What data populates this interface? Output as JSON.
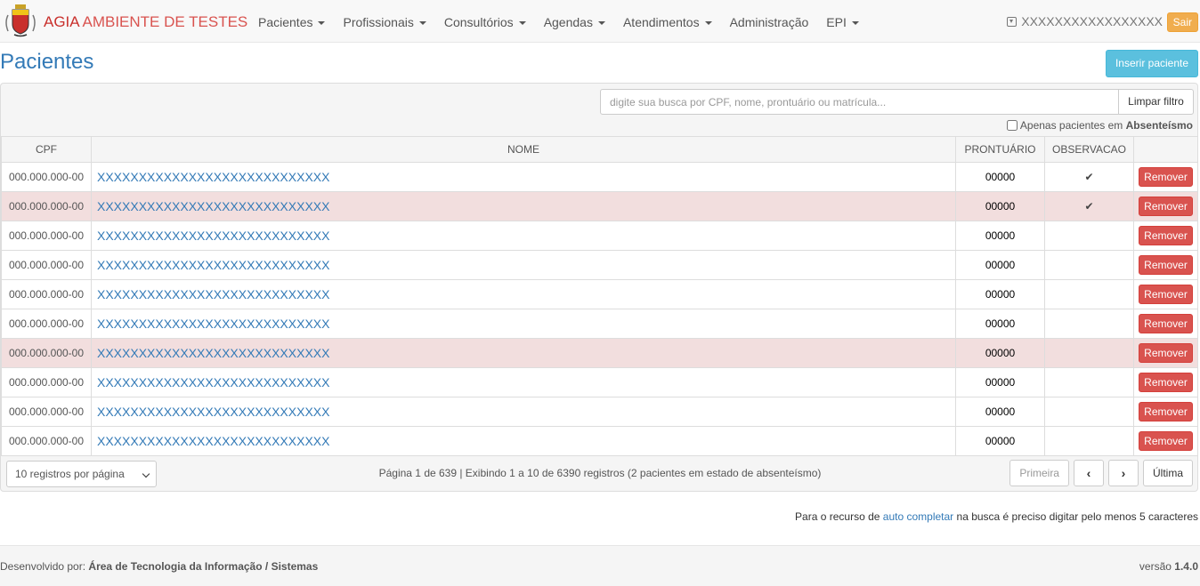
{
  "brand": {
    "name_part1": "AGIA",
    "name_part2": "AMBIENTE DE TESTES"
  },
  "nav": {
    "items": [
      {
        "label": "Pacientes",
        "dropdown": true
      },
      {
        "label": "Profissionais",
        "dropdown": true
      },
      {
        "label": "Consultórios",
        "dropdown": true
      },
      {
        "label": "Agendas",
        "dropdown": true
      },
      {
        "label": "Atendimentos",
        "dropdown": true
      },
      {
        "label": "Administração",
        "dropdown": false
      },
      {
        "label": "EPI",
        "dropdown": true
      }
    ],
    "user": "XXXXXXXXXXXXXXXXX",
    "logout_label": "Sair"
  },
  "page": {
    "title": "Pacientes",
    "insert_label": "Inserir paciente"
  },
  "search": {
    "placeholder": "digite sua busca por CPF, nome, prontuário ou matrícula...",
    "value": "",
    "clear_label": "Limpar filtro",
    "absent_label": "Apenas pacientes em",
    "absent_bold": "Absenteísmo",
    "absent_checked": false
  },
  "table": {
    "headers": {
      "cpf": "CPF",
      "nome": "NOME",
      "prontuario": "PRONTUÁRIO",
      "observacao": "OBSERVACAO"
    },
    "remove_label": "Remover",
    "rows": [
      {
        "cpf": "000.000.000-00",
        "nome": "XXXXXXXXXXXXXXXXXXXXXXXXXXXX",
        "prontuario": "00000",
        "obs": "✔",
        "highlight": false
      },
      {
        "cpf": "000.000.000-00",
        "nome": "XXXXXXXXXXXXXXXXXXXXXXXXXXXX",
        "prontuario": "00000",
        "obs": "✔",
        "highlight": true
      },
      {
        "cpf": "000.000.000-00",
        "nome": "XXXXXXXXXXXXXXXXXXXXXXXXXXXX",
        "prontuario": "00000",
        "obs": "",
        "highlight": false
      },
      {
        "cpf": "000.000.000-00",
        "nome": "XXXXXXXXXXXXXXXXXXXXXXXXXXXX",
        "prontuario": "00000",
        "obs": "",
        "highlight": false
      },
      {
        "cpf": "000.000.000-00",
        "nome": "XXXXXXXXXXXXXXXXXXXXXXXXXXXX",
        "prontuario": "00000",
        "obs": "",
        "highlight": false
      },
      {
        "cpf": "000.000.000-00",
        "nome": "XXXXXXXXXXXXXXXXXXXXXXXXXXXX",
        "prontuario": "00000",
        "obs": "",
        "highlight": false
      },
      {
        "cpf": "000.000.000-00",
        "nome": "XXXXXXXXXXXXXXXXXXXXXXXXXXXX",
        "prontuario": "00000",
        "obs": "",
        "highlight": true
      },
      {
        "cpf": "000.000.000-00",
        "nome": "XXXXXXXXXXXXXXXXXXXXXXXXXXXX",
        "prontuario": "00000",
        "obs": "",
        "highlight": false
      },
      {
        "cpf": "000.000.000-00",
        "nome": "XXXXXXXXXXXXXXXXXXXXXXXXXXXX",
        "prontuario": "00000",
        "obs": "",
        "highlight": false
      },
      {
        "cpf": "000.000.000-00",
        "nome": "XXXXXXXXXXXXXXXXXXXXXXXXXXXX",
        "prontuario": "00000",
        "obs": "",
        "highlight": false
      }
    ]
  },
  "pagination": {
    "per_page": "10 registros por página",
    "info": "Página 1 de 639 | Exibindo 1 a 10 de 6390 registros (2 pacientes em estado de absenteísmo)",
    "first": "Primeira",
    "prev": "‹",
    "next": "›",
    "last": "Última"
  },
  "note": {
    "before": "Para o recurso de",
    "link": "auto completar",
    "after": "na busca é preciso digitar pelo menos 5 caracteres"
  },
  "footer": {
    "dev_label": "Desenvolvido por:",
    "dev_name": "Área de Tecnologia da Informação / Sistemas",
    "version_label": "versão",
    "version": "1.4.0"
  },
  "colors": {
    "accent": "#337ab7",
    "danger": "#d9534f",
    "warning": "#f0ad4e",
    "info": "#5bc0de",
    "row_highlight": "#f2dede"
  }
}
